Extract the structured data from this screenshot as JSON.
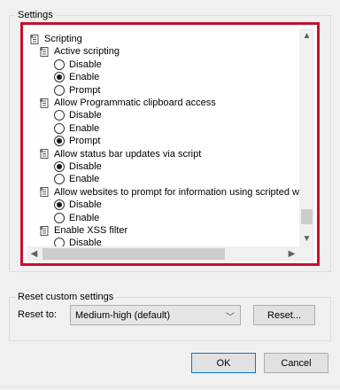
{
  "settings_group": {
    "label": "Settings"
  },
  "tree": {
    "rows": [
      {
        "kind": "category",
        "icon": "settings-category-icon",
        "label": "Scripting",
        "depth": 0
      },
      {
        "kind": "setting",
        "icon": "settings-item-icon",
        "label": "Active scripting",
        "depth": 1
      },
      {
        "kind": "radio",
        "label": "Disable",
        "checked": false,
        "depth": 2
      },
      {
        "kind": "radio",
        "label": "Enable",
        "checked": true,
        "depth": 2
      },
      {
        "kind": "radio",
        "label": "Prompt",
        "checked": false,
        "depth": 2
      },
      {
        "kind": "setting",
        "icon": "settings-item-icon",
        "label": "Allow Programmatic clipboard access",
        "depth": 1
      },
      {
        "kind": "radio",
        "label": "Disable",
        "checked": false,
        "depth": 2
      },
      {
        "kind": "radio",
        "label": "Enable",
        "checked": false,
        "depth": 2
      },
      {
        "kind": "radio",
        "label": "Prompt",
        "checked": true,
        "depth": 2
      },
      {
        "kind": "setting",
        "icon": "settings-item-icon",
        "label": "Allow status bar updates via script",
        "depth": 1
      },
      {
        "kind": "radio",
        "label": "Disable",
        "checked": true,
        "depth": 2
      },
      {
        "kind": "radio",
        "label": "Enable",
        "checked": false,
        "depth": 2
      },
      {
        "kind": "setting",
        "icon": "settings-item-icon",
        "label": "Allow websites to prompt for information using scripted wind",
        "depth": 1
      },
      {
        "kind": "radio",
        "label": "Disable",
        "checked": true,
        "depth": 2
      },
      {
        "kind": "radio",
        "label": "Enable",
        "checked": false,
        "depth": 2
      },
      {
        "kind": "setting",
        "icon": "settings-item-icon",
        "label": "Enable XSS filter",
        "depth": 1
      },
      {
        "kind": "radio",
        "label": "Disable",
        "checked": false,
        "depth": 2
      }
    ]
  },
  "scrollbars": {
    "up_icon": "chevron-up-icon",
    "down_icon": "chevron-down-icon",
    "left_icon": "chevron-left-icon",
    "right_icon": "chevron-right-icon"
  },
  "reset_group": {
    "label": "Reset custom settings",
    "reset_to_label": "Reset to:",
    "selected_level": "Medium-high (default)",
    "reset_button": "Reset..."
  },
  "dialog_buttons": {
    "ok": "OK",
    "cancel": "Cancel"
  },
  "colors": {
    "highlight_border": "#c8102e",
    "ok_border": "#0078d7"
  }
}
